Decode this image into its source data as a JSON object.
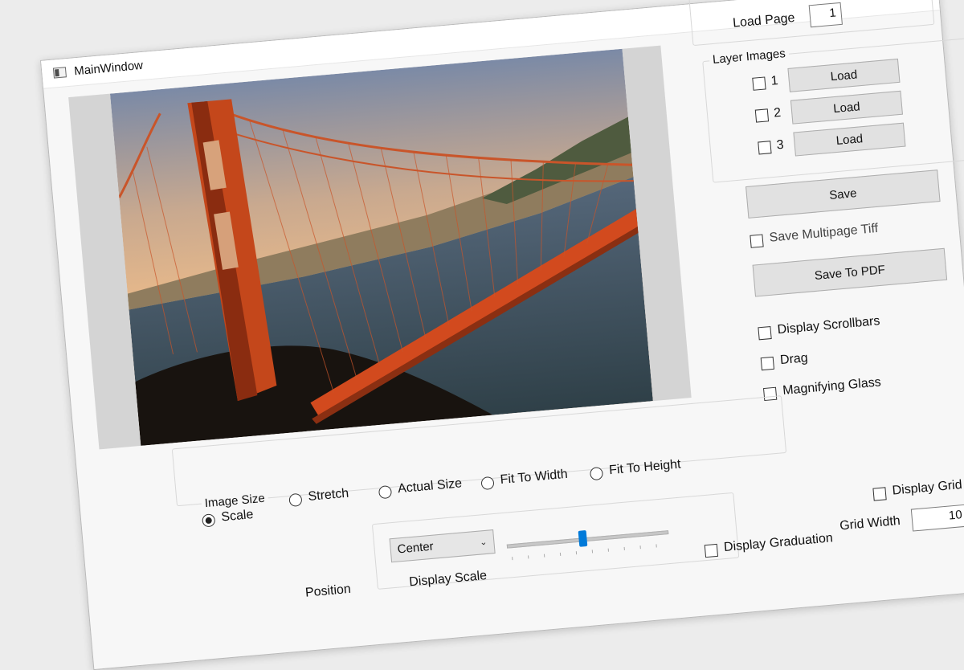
{
  "window": {
    "title": "MainWindow",
    "icon": "window-icon"
  },
  "load_page": {
    "label": "Load Page",
    "value": "1"
  },
  "layer_images": {
    "legend": "Layer Images",
    "items": [
      {
        "label": "1",
        "button": "Load",
        "checked": false
      },
      {
        "label": "2",
        "button": "Load",
        "checked": false
      },
      {
        "label": "3",
        "button": "Load",
        "checked": false
      }
    ]
  },
  "actions": {
    "save": "Save",
    "save_multipage": "Save Multipage Tiff",
    "save_pdf": "Save To PDF"
  },
  "options": {
    "display_scrollbars": "Display Scrollbars",
    "drag": "Drag",
    "magnifying_glass": "Magnifying Glass",
    "display_grid": "Display Grid",
    "grid_width_label": "Grid Width",
    "grid_width_value": "10",
    "display_graduation": "Display Graduation"
  },
  "image_size": {
    "legend": "Image Size",
    "options": [
      "Scale",
      "Stretch",
      "Actual Size",
      "Fit To Width",
      "Fit To Height"
    ],
    "selected": "Scale"
  },
  "position": {
    "label": "Position",
    "value": "Center"
  },
  "display_scale": {
    "label": "Display Scale"
  },
  "colors": {
    "accent": "#007ad9",
    "button_bg": "#e1e1e1",
    "window_bg": "#f7f7f7"
  }
}
